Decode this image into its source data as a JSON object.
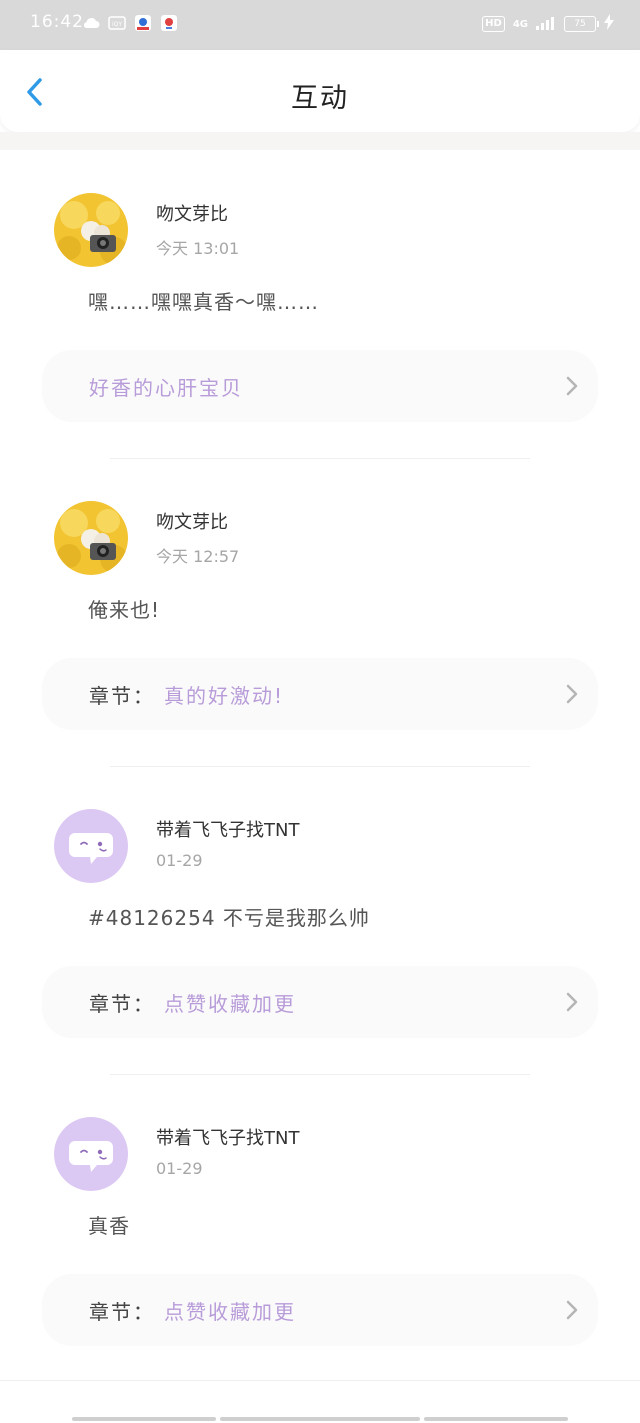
{
  "status_bar": {
    "time": "16:42",
    "hd": "HD",
    "network": "4G",
    "battery": "75"
  },
  "header": {
    "title": "互动"
  },
  "posts": [
    {
      "user": "吻文芽比",
      "time": "今天 13:01",
      "text": "嘿……嘿嘿真香～嘿……",
      "chapter_prefix": "",
      "chapter_title": "好香的心肝宝贝",
      "avatar": "yellow-fluffy-camera"
    },
    {
      "user": "吻文芽比",
      "time": "今天 12:57",
      "text": "俺来也!",
      "chapter_prefix": "章节：",
      "chapter_title": "真的好激动!",
      "avatar": "yellow-fluffy-camera"
    },
    {
      "user": "带着飞飞子找TNT",
      "time": "01-29",
      "text": "#48126254 不亏是我那么帅",
      "chapter_prefix": "章节：",
      "chapter_title": "点赞收藏加更",
      "avatar": "purple-chat-face"
    },
    {
      "user": "带着飞飞子找TNT",
      "time": "01-29",
      "text": "真香",
      "chapter_prefix": "章节：",
      "chapter_title": "点赞收藏加更",
      "avatar": "purple-chat-face"
    }
  ],
  "colors": {
    "accent": "#2f9ae6",
    "chapter_title": "#b89cd9",
    "avatar_purple": "#dcc9f3"
  }
}
